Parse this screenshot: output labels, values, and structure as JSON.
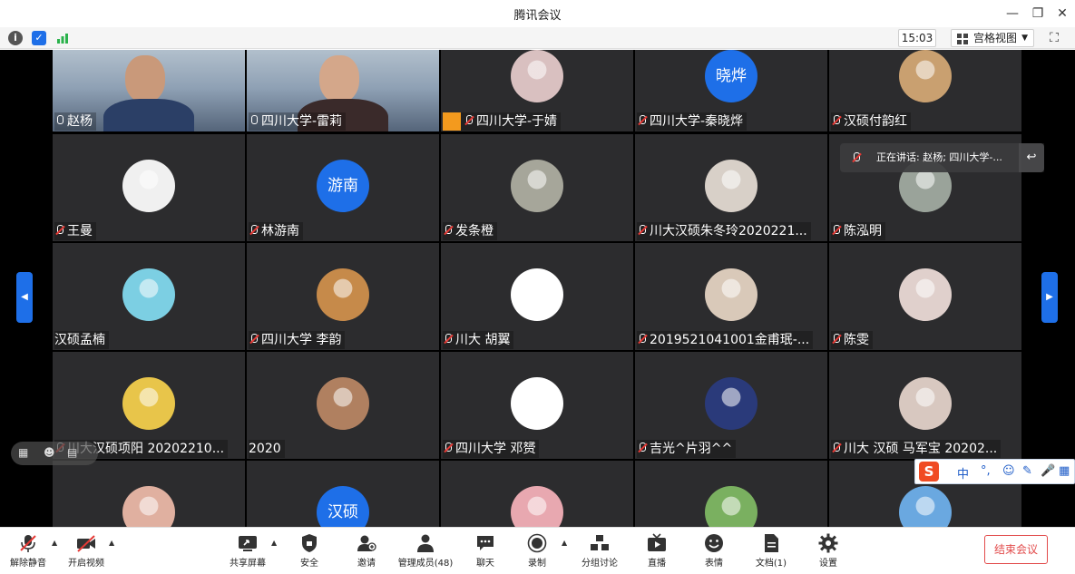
{
  "app": {
    "title": "腾讯会议"
  },
  "infobar": {
    "time": "15:03",
    "view_mode": "宫格视图"
  },
  "speaking": {
    "text": "正在讲话: 赵杨; 四川大学-..."
  },
  "tiles": [
    {
      "name": "赵杨",
      "mic": "on",
      "kind": "video",
      "avatar_color": "#6f7f8f"
    },
    {
      "name": "四川大学-雷莉",
      "mic": "on",
      "kind": "video",
      "avatar_color": "#8ea0b4"
    },
    {
      "name": "四川大学-于婧",
      "mic": "muted",
      "kind": "avatar",
      "avatar_color": "#d9c0c0",
      "host_badge": true
    },
    {
      "name": "四川大学-秦晓烨",
      "mic": "muted",
      "kind": "text",
      "avatar_text": "晓烨"
    },
    {
      "name": "汉硕付韵红",
      "mic": "muted",
      "kind": "avatar",
      "avatar_color": "#c9a070"
    },
    {
      "name": "王曼",
      "mic": "muted",
      "kind": "avatar",
      "avatar_color": "#f0f0f0"
    },
    {
      "name": "林游南",
      "mic": "muted",
      "kind": "text",
      "avatar_text": "游南"
    },
    {
      "name": "发条橙",
      "mic": "muted",
      "kind": "avatar",
      "avatar_color": "#a6a69a"
    },
    {
      "name": "川大汉硕朱冬玲2020221...",
      "mic": "muted",
      "kind": "avatar",
      "avatar_color": "#d8d0c8"
    },
    {
      "name": "陈泓明",
      "mic": "muted",
      "kind": "avatar",
      "avatar_color": "#9aa39a"
    },
    {
      "name": "汉硕孟楠",
      "mic": "none",
      "kind": "avatar",
      "avatar_color": "#7ccfe3"
    },
    {
      "name": "四川大学 李韵",
      "mic": "muted",
      "kind": "avatar",
      "avatar_color": "#c68a4a"
    },
    {
      "name": "川大 胡翼",
      "mic": "muted",
      "kind": "avatar",
      "avatar_color": "#ffffff"
    },
    {
      "name": "2019521041001金甫珉-...",
      "mic": "muted",
      "kind": "avatar",
      "avatar_color": "#d9c9b9"
    },
    {
      "name": "陈雯",
      "mic": "muted",
      "kind": "avatar",
      "avatar_color": "#e0d0cc"
    },
    {
      "name": "川大汉硕项阳 20202210...",
      "mic": "muted",
      "kind": "avatar",
      "avatar_color": "#e8c54a"
    },
    {
      "name": "2020",
      "mic": "none",
      "kind": "avatar",
      "avatar_color": "#b08060"
    },
    {
      "name": "四川大学 邓赟",
      "mic": "muted",
      "kind": "avatar",
      "avatar_color": "#ffffff"
    },
    {
      "name": "吉光^片羽^^",
      "mic": "muted",
      "kind": "avatar",
      "avatar_color": "#2a3a7a"
    },
    {
      "name": "川大 汉硕 马军宝 20202...",
      "mic": "muted",
      "kind": "avatar",
      "avatar_color": "#d8c8c0"
    },
    {
      "name": "",
      "mic": "none",
      "kind": "avatar",
      "avatar_color": "#e0b0a0"
    },
    {
      "name": "",
      "mic": "none",
      "kind": "text",
      "avatar_text": "汉硕"
    },
    {
      "name": "",
      "mic": "none",
      "kind": "avatar",
      "avatar_color": "#e8a8b0"
    },
    {
      "name": "",
      "mic": "none",
      "kind": "avatar",
      "avatar_color": "#7ab060"
    },
    {
      "name": "",
      "mic": "none",
      "kind": "avatar",
      "avatar_color": "#6aa8e0"
    }
  ],
  "ime": {
    "keys": [
      "中",
      "°,",
      "☺",
      "✎",
      "🎤",
      "▦"
    ]
  },
  "toolbar": {
    "unmute": "解除静音",
    "start_video": "开启视频",
    "share_screen": "共享屏幕",
    "security": "安全",
    "invite": "邀请",
    "members": "管理成员(48)",
    "chat": "聊天",
    "record": "录制",
    "breakout": "分组讨论",
    "live": "直播",
    "reactions": "表情",
    "docs": "文档(1)",
    "settings": "设置",
    "end_meeting": "结束会议"
  },
  "colors": {
    "accent": "#1e6fe8",
    "end": "#e24b4b",
    "tile_bg": "#2c2c2e"
  }
}
